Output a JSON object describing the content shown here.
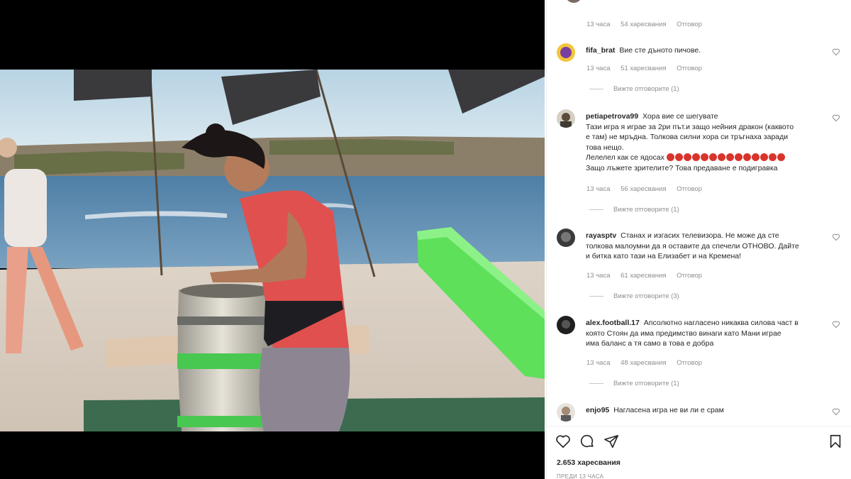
{
  "post": {
    "likes_text": "2.653 харесвания",
    "posted_text": "ПРЕДИ 13 ЧАСА"
  },
  "top_meta": {
    "time": "13 часа",
    "likes": "54 харесвания",
    "reply": "Отговор"
  },
  "comments": [
    {
      "user": "fifa_brat",
      "text": "Вие сте дъното пичове.",
      "time": "13 часа",
      "likes": "51 харесвания",
      "reply": "Отговор",
      "view_replies": "Вижте отговорите (1)"
    },
    {
      "user": "petiapetrova99",
      "text": "Хора вие се шегувате",
      "text_lines": [
        "Тази игра я играе за 2ри път.и защо нейния дракон (каквото",
        "е там) не мръдна. Толкова силни хора си тръгнаха заради",
        "това нещо.",
        "Лелелел как се ядосах",
        "Защо лъжете зрителите? Това предаване е подигравка"
      ],
      "time": "13 часа",
      "likes": "56 харесвания",
      "reply": "Отговор",
      "view_replies": "Вижте отговорите (1)"
    },
    {
      "user": "rayasptv",
      "text": "Станах и изгасих телевизора. Не може да сте",
      "text_lines": [
        "толкова малоумни да я оставите да спечели ОТНОВО. Дайте",
        "и битка като тази на Елизабет и на Кремена!"
      ],
      "time": "13 часа",
      "likes": "61 харесвания",
      "reply": "Отговор",
      "view_replies": "Вижте отговорите (3)"
    },
    {
      "user": "alex.football.17",
      "text": "Апсолютно нагласено никаква силова част в",
      "text_lines": [
        "която Стоян да има предимство винаги като Мани играе",
        "има баланс а тя само в това е добра"
      ],
      "time": "13 часа",
      "likes": "48 харесвания",
      "reply": "Отговор",
      "view_replies": "Вижте отговорите (1)"
    },
    {
      "user": "enjo95",
      "text": "Нагласена игра не ви ли е срам"
    }
  ],
  "icons": {
    "like": "heart-icon",
    "comment": "comment-icon",
    "share": "share-icon",
    "save": "bookmark-icon"
  },
  "colors": {
    "text": "#262626",
    "muted": "#8e8e8e",
    "border": "#efefef",
    "emoji": "#d9342b"
  }
}
